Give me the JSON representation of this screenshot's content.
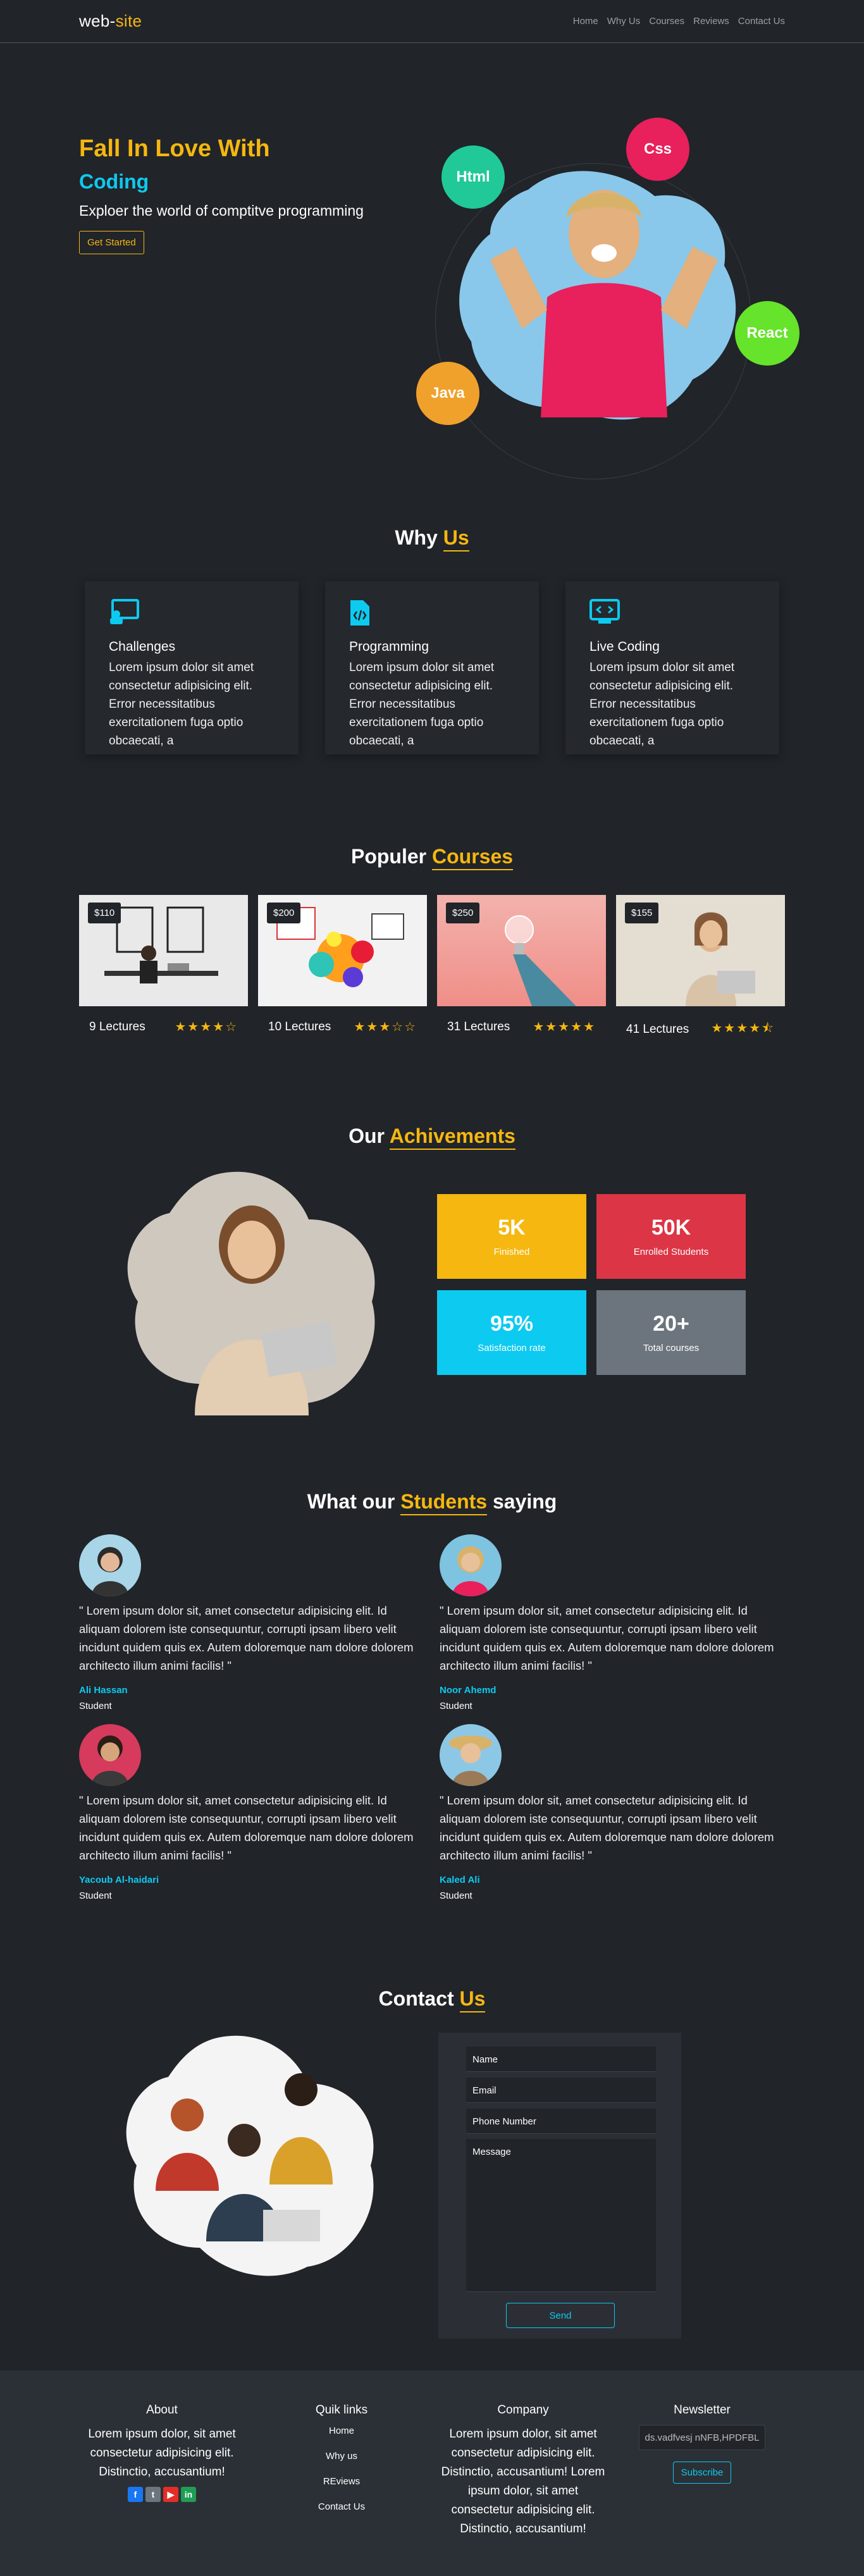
{
  "colors": {
    "bg": "#212429",
    "accent_yellow": "#f5b710",
    "accent_cyan": "#0dcaf0",
    "danger": "#dc3545",
    "gray": "#6c757d"
  },
  "nav": {
    "logo_part1": "web-",
    "logo_part2": "site",
    "links": [
      "Home",
      "Why Us",
      "Courses",
      "Reviews",
      "Contact Us"
    ]
  },
  "hero": {
    "title": "Fall In Love With",
    "subtitle": "Coding",
    "description": "Exploer the world of comptitve programming",
    "cta": "Get Started",
    "bubbles": [
      "Html",
      "Css",
      "React",
      "Java"
    ]
  },
  "why": {
    "title_part1": "Why ",
    "title_part2": "Us",
    "cards": [
      {
        "icon": "presentation-icon",
        "title": "Challenges",
        "text": "Lorem ipsum dolor sit amet consectetur adipisicing elit. Error necessitatibus exercitationem fuga optio obcaecati, a"
      },
      {
        "icon": "code-file-icon",
        "title": "Programming",
        "text": "Lorem ipsum dolor sit amet consectetur adipisicing elit. Error necessitatibus exercitationem fuga optio obcaecati, a"
      },
      {
        "icon": "code-window-icon",
        "title": "Live Coding",
        "text": "Lorem ipsum dolor sit amet consectetur adipisicing elit. Error necessitatibus exercitationem fuga optio obcaecati, a"
      }
    ]
  },
  "courses": {
    "title_part1": "Populer ",
    "title_part2": "Courses",
    "items": [
      {
        "price": "$110",
        "lectures": "9 Lectures",
        "rating": 4
      },
      {
        "price": "$200",
        "lectures": "10 Lectures",
        "rating": 3
      },
      {
        "price": "$250",
        "lectures": "31 Lectures",
        "rating": 5
      },
      {
        "price": "$155",
        "lectures": "41 Lectures",
        "rating": 4.5
      }
    ]
  },
  "achievements": {
    "title_part1": "Our ",
    "title_part2": "Achivements",
    "stats": [
      {
        "value": "5K",
        "label": "Finished"
      },
      {
        "value": "50K",
        "label": "Enrolled Students"
      },
      {
        "value": "95%",
        "label": "Satisfaction rate"
      },
      {
        "value": "20+",
        "label": "Total courses"
      }
    ]
  },
  "testimonials": {
    "title_part1": "What our ",
    "title_part2": "Students",
    "title_part3": " saying",
    "items": [
      {
        "quote": "\" Lorem ipsum dolor sit, amet consectetur adipisicing elit. Id aliquam dolorem iste consequuntur, corrupti ipsam libero velit incidunt quidem quis ex. Autem doloremque nam dolore dolorem architecto illum animi facilis! \"",
        "name": "Ali Hassan",
        "role": "Student"
      },
      {
        "quote": "\" Lorem ipsum dolor sit, amet consectetur adipisicing elit. Id aliquam dolorem iste consequuntur, corrupti ipsam libero velit incidunt quidem quis ex. Autem doloremque nam dolore dolorem architecto illum animi facilis! \"",
        "name": "Noor Ahemd",
        "role": "Student"
      },
      {
        "quote": "\" Lorem ipsum dolor sit, amet consectetur adipisicing elit. Id aliquam dolorem iste consequuntur, corrupti ipsam libero velit incidunt quidem quis ex. Autem doloremque nam dolore dolorem architecto illum animi facilis! \"",
        "name": "Yacoub Al-haidari",
        "role": "Student"
      },
      {
        "quote": "\" Lorem ipsum dolor sit, amet consectetur adipisicing elit. Id aliquam dolorem iste consequuntur, corrupti ipsam libero velit incidunt quidem quis ex. Autem doloremque nam dolore dolorem architecto illum animi facilis! \"",
        "name": "Kaled Ali",
        "role": "Student"
      }
    ]
  },
  "contact": {
    "title_part1": "Contact ",
    "title_part2": "Us",
    "name_placeholder": "Name",
    "email_placeholder": "Email",
    "phone_placeholder": "Phone Number",
    "message_placeholder": "Message",
    "send": "Send"
  },
  "footer": {
    "about_title": "About",
    "about_text": "Lorem ipsum dolor, sit amet consectetur adipisicing elit. Distinctio, accusantium!",
    "links_title": "Quik links",
    "links": [
      "Home",
      "Why us",
      "REviews",
      "Contact Us"
    ],
    "company_title": "Company",
    "company_text": "Lorem ipsum dolor, sit amet consectetur adipisicing elit. Distinctio, accusantium! Lorem ipsum dolor, sit amet consectetur adipisicing elit. Distinctio, accusantium!",
    "newsletter_title": "Newsletter",
    "newsletter_value": "ds.vadfvesj nNFB,HPDFBL",
    "subscribe": "Subscribe",
    "social": [
      "facebook-icon",
      "twitter-icon",
      "youtube-icon",
      "linkedin-icon"
    ]
  }
}
